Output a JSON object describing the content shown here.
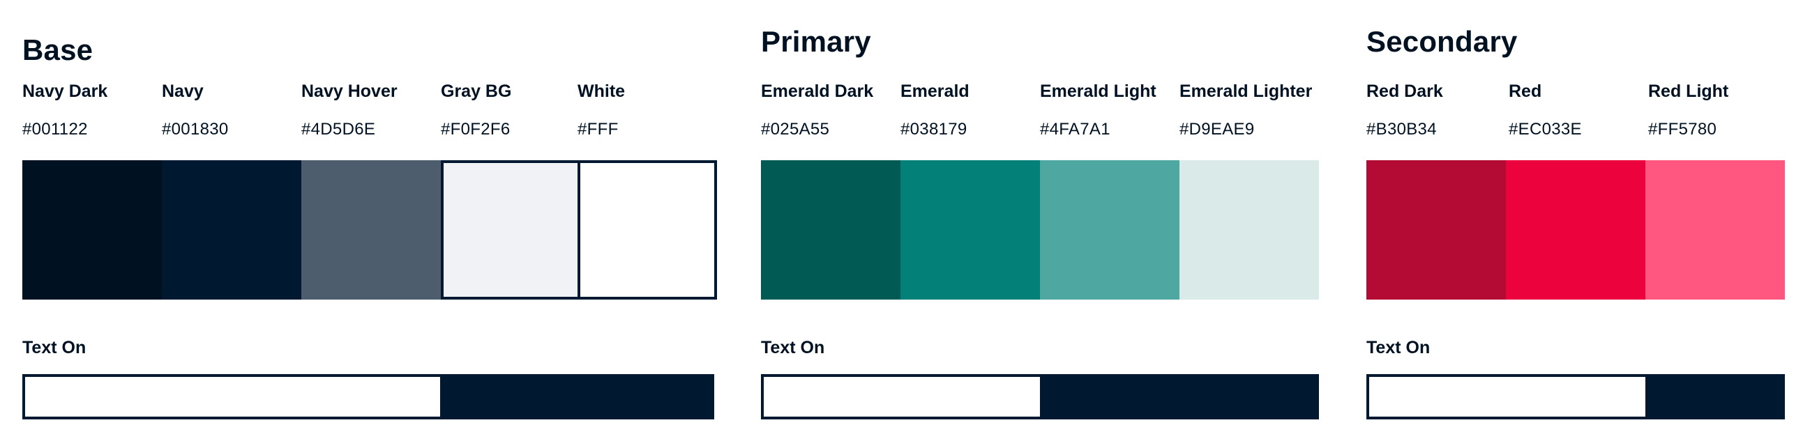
{
  "base": {
    "title": "Base",
    "colors": [
      {
        "name": "Navy Dark",
        "hex": "#001122",
        "fill": "#001122"
      },
      {
        "name": "Navy",
        "hex": "#001830",
        "fill": "#001830"
      },
      {
        "name": "Navy Hover",
        "hex": "#4D5D6E",
        "fill": "#4D5D6E"
      },
      {
        "name": "Gray BG",
        "hex": "#F0F2F6",
        "fill": "#F0F2F6"
      },
      {
        "name": "White",
        "hex": "#FFF",
        "fill": "#FFFFFF"
      }
    ],
    "text_on_label": "Text On"
  },
  "primary": {
    "title": "Primary",
    "colors": [
      {
        "name": "Emerald Dark",
        "hex": "#025A55",
        "fill": "#025A55"
      },
      {
        "name": "Emerald",
        "hex": "#038179",
        "fill": "#038179"
      },
      {
        "name": "Emerald Light",
        "hex": "#4FA7A1",
        "fill": "#4FA7A1"
      },
      {
        "name": "Emerald Lighter",
        "hex": "#D9EAE9",
        "fill": "#D9EAE9"
      }
    ],
    "text_on_label": "Text On"
  },
  "secondary": {
    "title": "Secondary",
    "colors": [
      {
        "name": "Red Dark",
        "hex": "#B30B34",
        "fill": "#B30B34"
      },
      {
        "name": "Red",
        "hex": "#EC033E",
        "fill": "#EC033E"
      },
      {
        "name": "Red Light",
        "hex": "#FF5780",
        "fill": "#FF5780"
      }
    ],
    "text_on_label": "Text On"
  }
}
